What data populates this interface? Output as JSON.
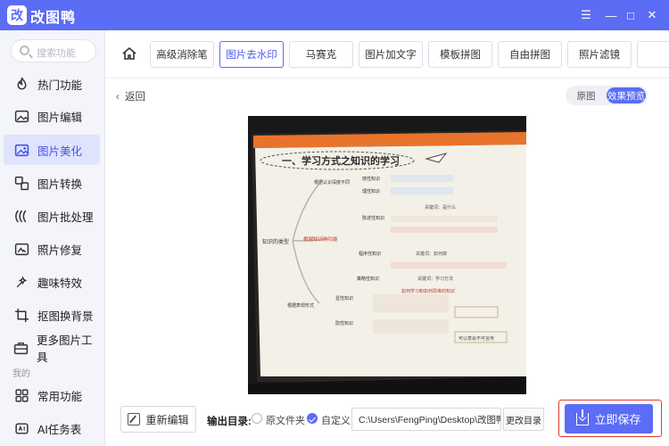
{
  "app": {
    "logo_char": "改",
    "title": "改图鸭"
  },
  "window_controls": [
    "☰",
    "—",
    "□",
    "✕"
  ],
  "sidebar": {
    "search_placeholder": "搜索功能",
    "items": [
      {
        "label": "热门功能",
        "icon": "flame-icon"
      },
      {
        "label": "图片编辑",
        "icon": "image-edit-icon"
      },
      {
        "label": "图片美化",
        "icon": "image-beautify-icon",
        "active": true
      },
      {
        "label": "图片转换",
        "icon": "convert-icon"
      },
      {
        "label": "图片批处理",
        "icon": "batch-icon"
      },
      {
        "label": "照片修复",
        "icon": "photo-repair-icon"
      },
      {
        "label": "趣味特效",
        "icon": "sparkle-icon"
      },
      {
        "label": "抠图换背景",
        "icon": "crop-icon"
      },
      {
        "label": "更多图片工具",
        "icon": "toolbox-icon"
      }
    ],
    "mine_label": "我的",
    "mine_items": [
      {
        "label": "常用功能",
        "icon": "grid-icon"
      },
      {
        "label": "AI任务表",
        "icon": "ai-icon"
      }
    ]
  },
  "tabs": [
    "高级消除笔",
    "图片去水印",
    "马赛克",
    "图片加文字",
    "模板拼图",
    "自由拼图",
    "照片滤镜"
  ],
  "main": {
    "back_label": "返回",
    "toggle_original": "原图",
    "toggle_preview": "效果预览"
  },
  "photo": {
    "heading": "一、学习方式之知识的学习",
    "root": "知识的类型",
    "nodes": [
      "根据认识深度不同",
      "感性知识",
      "理性知识",
      "根据知识的功能",
      "陈述性知识",
      "程序性知识",
      "策略性知识",
      "根据表现形式",
      "显性知识",
      "隐性知识"
    ],
    "notes": [
      "关键词：是什么",
      "关键词：如何做",
      "关键词：学习方法",
      "如何学习和如何思维的知识",
      "能够用语言、文字、符号等方式表达清楚的知识",
      "难以言传的知识",
      "可以意会不可言传"
    ]
  },
  "bottom": {
    "reedit_label": "重新编辑",
    "output_label": "输出目录:",
    "option_original": "原文件夹",
    "option_custom": "自定义",
    "path": "C:\\Users\\FengPing\\Desktop\\改图鸭",
    "change_dir": "更改目录",
    "save_label": "立即保存"
  },
  "colors": {
    "accent": "#5b6cf5",
    "highlight": "#e03a2d",
    "sidebar_bg": "#f3f5fb"
  }
}
